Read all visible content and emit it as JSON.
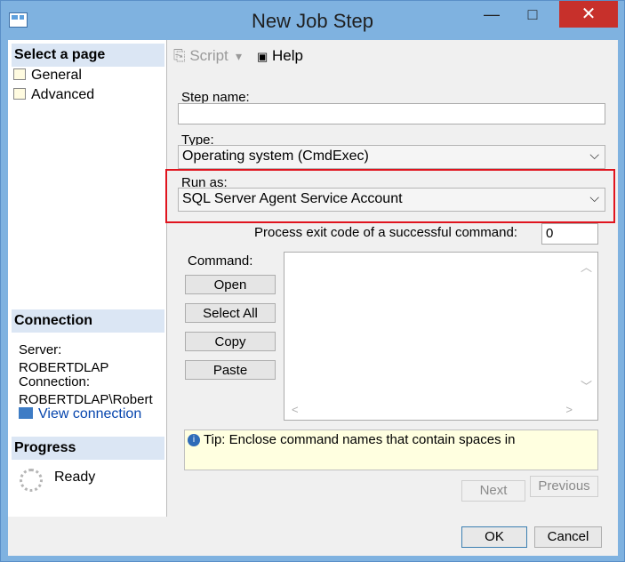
{
  "window": {
    "title": "New Job Step",
    "minimize": "—",
    "maximize": "□",
    "close": "✕"
  },
  "left_panel": {
    "select_page_header": "Select a page",
    "pages": [
      {
        "label": "General"
      },
      {
        "label": "Advanced"
      }
    ],
    "connection_header": "Connection",
    "server_label": "Server:",
    "server_value": "ROBERTDLAP",
    "connection_label": "Connection:",
    "connection_value": "ROBERTDLAP\\Robert",
    "view_connection": "View connection",
    "progress_header": "Progress",
    "progress_status": "Ready"
  },
  "toolbar": {
    "script_label": "Script",
    "script_arrow": "▾",
    "help_label": "Help"
  },
  "form": {
    "step_name_label": "Step name:",
    "step_name_value": "",
    "type_label": "Type:",
    "type_value": "Operating system (CmdExec)",
    "run_as_label": "Run as:",
    "run_as_value": "SQL Server Agent Service Account",
    "exit_code_label": "Process exit code of a successful command:",
    "exit_code_value": "0",
    "command_label": "Command:",
    "command_buttons": [
      "Open",
      "Select All",
      "Copy",
      "Paste"
    ],
    "tip": "Tip: Enclose command names that contain spaces in",
    "next_label": "Next",
    "previous_label": "Previous"
  },
  "footer": {
    "ok_label": "OK",
    "cancel_label": "Cancel"
  },
  "colors": {
    "highlight_border": "#e0141e",
    "close_button": "#c7302b",
    "section_header": "#dbe6f4"
  }
}
